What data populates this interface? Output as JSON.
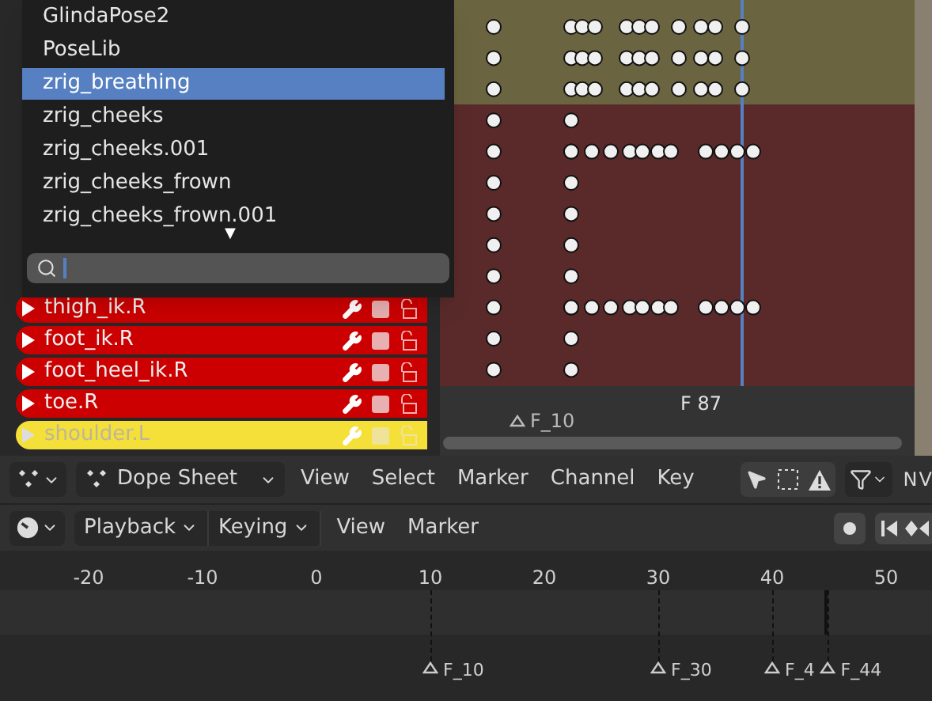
{
  "action_menu": {
    "items": [
      {
        "label": "GlindaPose2",
        "selected": false
      },
      {
        "label": "PoseLib",
        "selected": false
      },
      {
        "label": "zrig_breathing",
        "selected": true
      },
      {
        "label": "zrig_cheeks",
        "selected": false
      },
      {
        "label": "zrig_cheeks.001",
        "selected": false
      },
      {
        "label": "zrig_cheeks_frown",
        "selected": false
      },
      {
        "label": "zrig_cheeks_frown.001",
        "selected": false
      }
    ],
    "more_arrow": "▼"
  },
  "channels": [
    {
      "name": "thigh_ik.R",
      "color": "#cc0000",
      "selected": true
    },
    {
      "name": "foot_ik.R",
      "color": "#cc0000",
      "selected": true
    },
    {
      "name": "foot_heel_ik.R",
      "color": "#cc0000",
      "selected": true
    },
    {
      "name": "toe.R",
      "color": "#cc0000",
      "selected": true
    },
    {
      "name": "shoulder.L",
      "color": "#f5e03a",
      "selected": false
    }
  ],
  "dope_sheet": {
    "marker_label": "F_10",
    "current_frame_label": "F 87"
  },
  "header": {
    "editor_type": "Dope Sheet",
    "menus": [
      "View",
      "Select",
      "Marker",
      "Channel",
      "Key"
    ],
    "cut_labels": [
      "N",
      "V"
    ]
  },
  "timeline": {
    "dropdown_menus": [
      "Playback",
      "Keying"
    ],
    "menus": [
      "View",
      "Marker"
    ],
    "ruler": [
      "-20",
      "-10",
      "0",
      "10",
      "20",
      "30",
      "40",
      "50"
    ],
    "markers": [
      {
        "label": "F_10"
      },
      {
        "label": "F_30"
      },
      {
        "label": "F_4"
      },
      {
        "label": "F_44"
      }
    ]
  }
}
